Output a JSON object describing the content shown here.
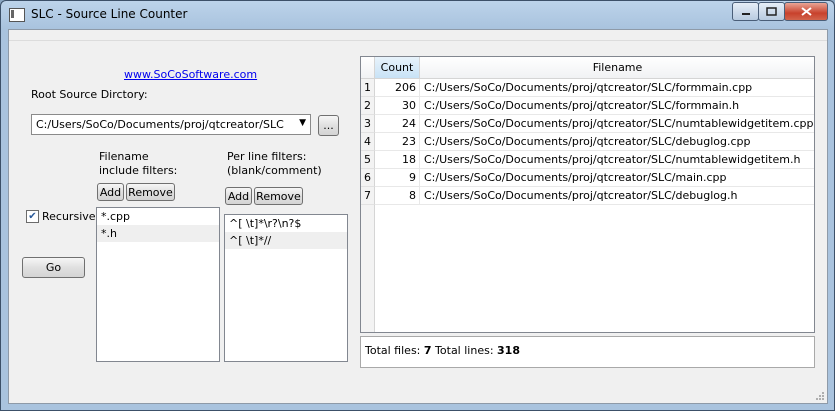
{
  "window": {
    "title": "SLC - Source Line Counter",
    "icon": "app-window-icon"
  },
  "link": {
    "text": "www.SoCoSoftware.com"
  },
  "root_dir": {
    "label": "Root Source Dirctory:",
    "value": "C:/Users/SoCo/Documents/proj/qtcreator/SLC",
    "browse_label": "..."
  },
  "filename_filters": {
    "label_line1": "Filename",
    "label_line2": "include filters:",
    "add_label": "Add",
    "remove_label": "Remove",
    "items": [
      "*.cpp",
      "*.h"
    ]
  },
  "line_filters": {
    "label_line1": "Per line filters:",
    "label_line2": "(blank/comment)",
    "add_label": "Add",
    "remove_label": "Remove",
    "items": [
      "^[ \\t]*\\r?\\n?$",
      "^[ \\t]*//"
    ]
  },
  "recursive": {
    "label": "Recursive",
    "checked": true
  },
  "go": {
    "label": "Go"
  },
  "results": {
    "columns": [
      "Count",
      "Filename"
    ],
    "rows": [
      {
        "n": "1",
        "count": "206",
        "file": "C:/Users/SoCo/Documents/proj/qtcreator/SLC/formmain.cpp"
      },
      {
        "n": "2",
        "count": "30",
        "file": "C:/Users/SoCo/Documents/proj/qtcreator/SLC/formmain.h"
      },
      {
        "n": "3",
        "count": "24",
        "file": "C:/Users/SoCo/Documents/proj/qtcreator/SLC/numtablewidgetitem.cpp"
      },
      {
        "n": "4",
        "count": "23",
        "file": "C:/Users/SoCo/Documents/proj/qtcreator/SLC/debuglog.cpp"
      },
      {
        "n": "5",
        "count": "18",
        "file": "C:/Users/SoCo/Documents/proj/qtcreator/SLC/numtablewidgetitem.h"
      },
      {
        "n": "6",
        "count": "9",
        "file": "C:/Users/SoCo/Documents/proj/qtcreator/SLC/main.cpp"
      },
      {
        "n": "7",
        "count": "8",
        "file": "C:/Users/SoCo/Documents/proj/qtcreator/SLC/debuglog.h"
      }
    ]
  },
  "status": {
    "files_label": "Total files:",
    "files_value": "7",
    "lines_label": "Total lines:",
    "lines_value": "318"
  }
}
